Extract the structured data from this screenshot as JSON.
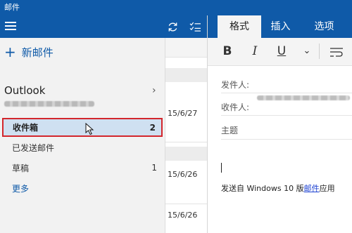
{
  "window": {
    "title": "邮件"
  },
  "nav": {
    "new_mail_label": "新邮件",
    "account_name": "Outlook",
    "folders": [
      {
        "label": "收件箱",
        "count": "2"
      },
      {
        "label": "已发送邮件",
        "count": ""
      },
      {
        "label": "草稿",
        "count": "1"
      },
      {
        "label": "更多",
        "count": ""
      }
    ]
  },
  "list": {
    "dates": [
      "15/6/27",
      "15/6/26",
      "15/6/26"
    ]
  },
  "compose": {
    "tabs": [
      "格式",
      "插入",
      "选项"
    ],
    "active_tab": "格式",
    "toolbar": {
      "bold": "B",
      "italic": "I",
      "underline": "U",
      "more": "⌄"
    },
    "fields": {
      "from_label": "发件人:",
      "to_label": "收件人:",
      "subject_label": "主题"
    },
    "signature": {
      "prefix": "发送自 Windows 10 版",
      "link": "邮件",
      "suffix": "应用"
    }
  },
  "colors": {
    "accent": "#0f5aa8",
    "selected_bg": "#cfe0f1",
    "highlight_border": "#d3262c"
  }
}
